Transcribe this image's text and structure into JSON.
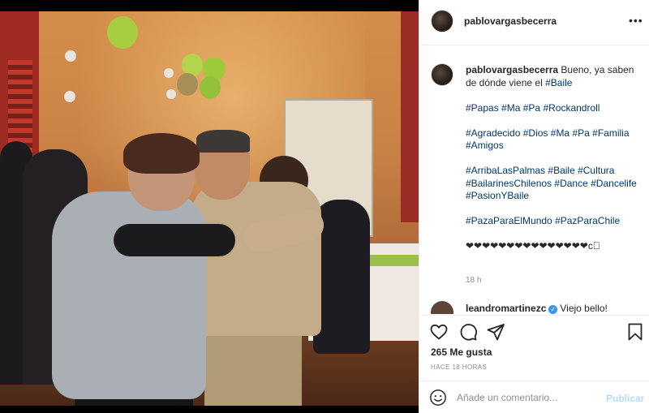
{
  "post": {
    "username": "pablovargasbecerra",
    "more_icon": "•••"
  },
  "caption": {
    "username": "pablovargasbecerra",
    "text": "Bueno, ya saben de dónde viene el ",
    "tag_first": "#Baile",
    "block1": [
      "#Papas",
      "#Ma",
      "#Pa",
      "#Rockandroll"
    ],
    "block2": [
      "#Agradecido",
      "#Dios",
      "#Ma",
      "#Pa",
      "#Familia",
      "#Amigos"
    ],
    "block3": [
      "#ArribaLasPalmas",
      "#Baile",
      "#Cultura",
      "#BailarinesChilenos",
      "#Dance",
      "#Dancelife",
      "#PasionYBaile"
    ],
    "block4": [
      "#PazaParaElMundo",
      "#PazParaChile"
    ],
    "hearts": "❤❤❤❤❤❤❤❤❤❤❤❤❤❤❤c⃣",
    "time": "18 h"
  },
  "reply": {
    "username": "leandromartinezc",
    "text": "Viejo bello!"
  },
  "actions": {
    "likes": "265 Me gusta",
    "posted": "HACE 18 HORAS"
  },
  "add_comment": {
    "placeholder": "Añade un comentario...",
    "publish": "Publicar"
  },
  "icons": [
    "heart-icon",
    "comment-icon",
    "share-icon",
    "bookmark-icon",
    "emoji-icon",
    "more-icon"
  ],
  "colors": {
    "hashtag": "#00376b",
    "publish_disabled": "#b3dbff",
    "meta": "#8e8e8e"
  }
}
